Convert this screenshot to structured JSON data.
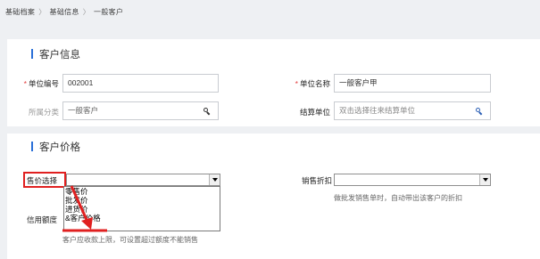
{
  "breadcrumb": [
    "基础档案",
    "基础信息",
    "一般客户"
  ],
  "section_customer_info": {
    "title": "客户信息",
    "unit_code_label": "单位编号",
    "unit_code_value": "002001",
    "unit_name_label": "单位名称",
    "unit_name_value": "一般客户甲",
    "category_label": "所属分类",
    "category_value": "一般客户",
    "settle_unit_label": "结算单位",
    "settle_unit_placeholder": "双击选择往来结算单位"
  },
  "section_customer_price": {
    "title": "客户价格",
    "price_select_label": "售价选择",
    "price_select_value": "",
    "price_options": [
      "零售价",
      "批发价",
      "进货价",
      "&客户价格"
    ],
    "sales_discount_label": "销售折扣",
    "sales_discount_value": "",
    "sales_discount_hint": "做批发销售单时，自动带出该客户的折扣",
    "credit_limit_label": "信用额度",
    "credit_limit_hint": "客户应收款上限，可设置超过额度不能销售"
  },
  "colors": {
    "accent_bar": "#2a6fd8",
    "required_star": "#e23b3b",
    "highlight": "#e02020"
  }
}
